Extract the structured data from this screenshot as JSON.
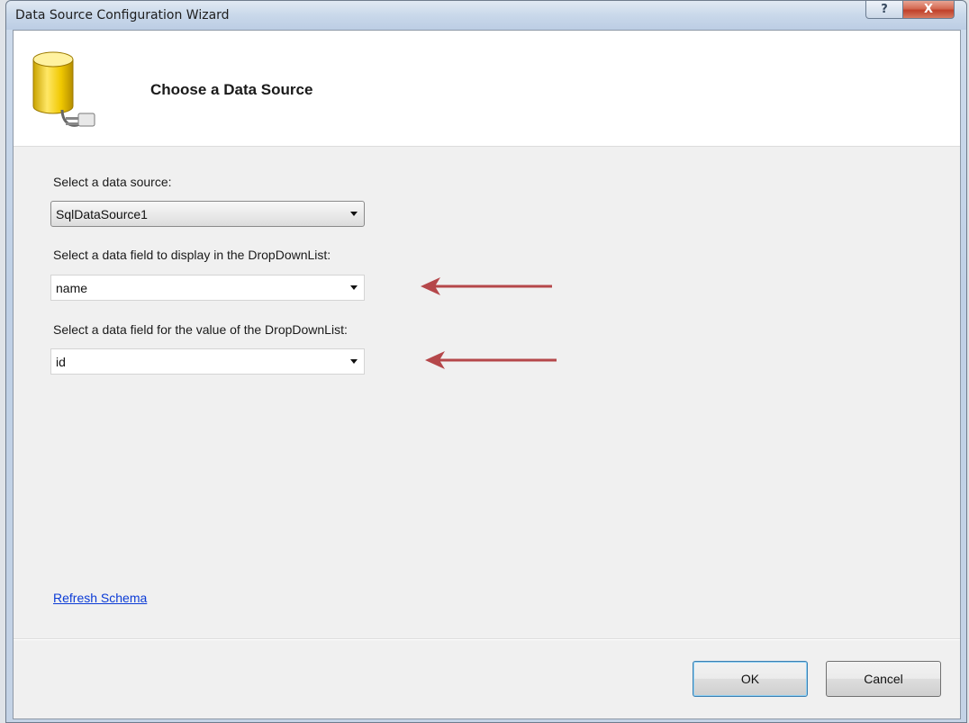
{
  "window": {
    "title": "Data Source Configuration Wizard",
    "help_glyph": "?",
    "close_glyph": "X"
  },
  "header": {
    "title": "Choose a Data Source",
    "icon": "database-plug-icon"
  },
  "fields": {
    "data_source": {
      "label": "Select a data source:",
      "value": "SqlDataSource1"
    },
    "display_field": {
      "label": "Select a data field to display in the DropDownList:",
      "value": "name"
    },
    "value_field": {
      "label": "Select a data field for the value of the DropDownList:",
      "value": "id"
    }
  },
  "links": {
    "refresh_schema": "Refresh Schema"
  },
  "buttons": {
    "ok": "OK",
    "cancel": "Cancel"
  },
  "colors": {
    "annotation_arrow": "#b5474a",
    "link": "#0b3bd6"
  }
}
